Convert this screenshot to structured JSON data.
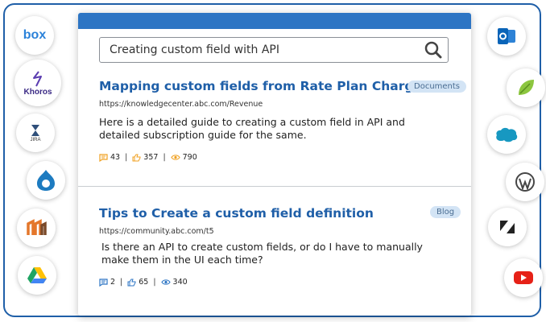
{
  "search": {
    "query": "Creating custom field with API"
  },
  "results": [
    {
      "title": "Mapping custom fields from Rate Plan Charge",
      "tag": "Documents",
      "url": "https://knowledgecenter.abc.com/Revenue",
      "description_line1": "Here is a detailed guide to creating a custom field in API and",
      "description_line2": "detailed subscription guide for the same.",
      "comments": "43",
      "likes": "357",
      "views": "790"
    },
    {
      "title": "Tips to Create a custom field definition",
      "tag": "Blog",
      "url": "https://community.abc.com/t5",
      "description_line1": "Is there an API to create custom fields, or do I have to manually",
      "description_line2": "make them in the UI each time?",
      "comments": "2",
      "likes": "65",
      "views": "340"
    }
  ],
  "integrations": {
    "left": [
      "box",
      "Khoros",
      "jira",
      "drupal",
      "magento",
      "google-drive"
    ],
    "right": [
      "outlook",
      "leaf-app",
      "salesforce",
      "wordpress",
      "zendesk",
      "youtube"
    ],
    "box_label": "box",
    "khoros_label": "Khoros",
    "jira_label": "JIRA"
  },
  "colors": {
    "accent": "#1f5fa8",
    "header_bar": "#2d75c4",
    "stat_icon": "#f0a020",
    "stat_icon_blue": "#2d75c4"
  }
}
